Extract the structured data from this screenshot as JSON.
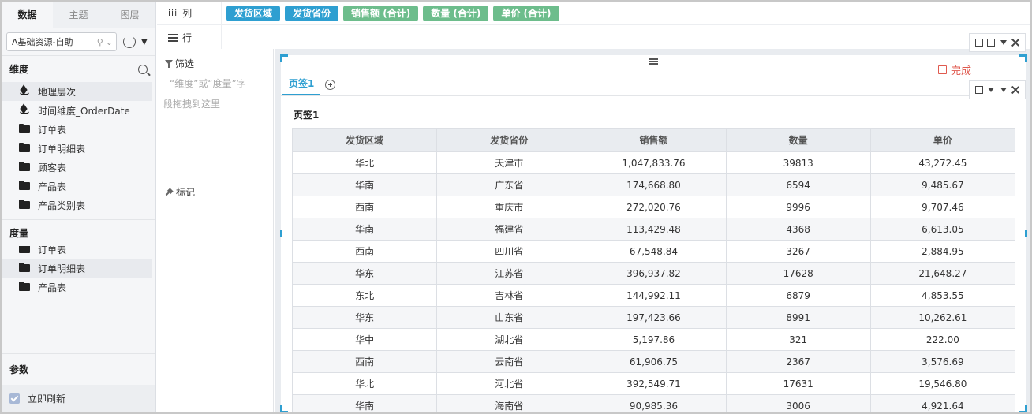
{
  "left_panel": {
    "tabs": [
      {
        "label": "数据",
        "active": true
      },
      {
        "label": "主题",
        "active": false
      },
      {
        "label": "图层",
        "active": false
      }
    ],
    "datasource": {
      "value": "A基础资源-自助"
    },
    "dimension": {
      "title": "维度",
      "items": [
        {
          "label": "地理层次",
          "icon": "layers-icon",
          "selected": true
        },
        {
          "label": "时间维度_OrderDate",
          "icon": "layers-icon",
          "selected": false
        },
        {
          "label": "订单表",
          "icon": "folder-icon",
          "selected": false
        },
        {
          "label": "订单明细表",
          "icon": "folder-icon",
          "selected": false
        },
        {
          "label": "顾客表",
          "icon": "folder-icon",
          "selected": false
        },
        {
          "label": "产品表",
          "icon": "folder-icon",
          "selected": false
        },
        {
          "label": "产品类别表",
          "icon": "folder-icon",
          "selected": false
        }
      ]
    },
    "measure": {
      "title": "度量",
      "items": [
        {
          "label": "订单表",
          "selected": false
        },
        {
          "label": "订单明细表",
          "selected": true
        },
        {
          "label": "产品表",
          "selected": false
        }
      ]
    },
    "params": {
      "title": "参数"
    },
    "instant_refresh": {
      "label": "立即刷新",
      "checked": true
    }
  },
  "shelves": {
    "column": {
      "label": "列",
      "pills": [
        {
          "label": "发货区域",
          "kind": "dimension"
        },
        {
          "label": "发货省份",
          "kind": "dimension"
        },
        {
          "label": "销售额 (合计)",
          "kind": "measure"
        },
        {
          "label": "数量 (合计)",
          "kind": "measure"
        },
        {
          "label": "单价 (合计)",
          "kind": "measure"
        }
      ]
    },
    "row": {
      "label": "行"
    }
  },
  "middle_panel": {
    "filter": {
      "title": "筛选",
      "hint_line1": "“维度”或“度量”字",
      "hint_line2": "段拖拽到这里"
    },
    "marks": {
      "title": "标记"
    }
  },
  "canvas": {
    "done_label": "完成",
    "tab": {
      "label": "页签1"
    },
    "table": {
      "title": "页签1",
      "columns": [
        "发货区域",
        "发货省份",
        "销售额",
        "数量",
        "单价"
      ],
      "rows": [
        [
          "华北",
          "天津市",
          "1,047,833.76",
          "39813",
          "43,272.45"
        ],
        [
          "华南",
          "广东省",
          "174,668.80",
          "6594",
          "9,485.67"
        ],
        [
          "西南",
          "重庆市",
          "272,020.76",
          "9996",
          "9,707.46"
        ],
        [
          "华南",
          "福建省",
          "113,429.48",
          "4368",
          "6,613.05"
        ],
        [
          "西南",
          "四川省",
          "67,548.84",
          "3267",
          "2,884.95"
        ],
        [
          "华东",
          "江苏省",
          "396,937.82",
          "17628",
          "21,648.27"
        ],
        [
          "东北",
          "吉林省",
          "144,992.11",
          "6879",
          "4,853.55"
        ],
        [
          "华东",
          "山东省",
          "197,423.66",
          "8991",
          "10,262.61"
        ],
        [
          "华中",
          "湖北省",
          "5,197.86",
          "321",
          "222.00"
        ],
        [
          "西南",
          "云南省",
          "61,906.75",
          "2367",
          "3,576.69"
        ],
        [
          "华北",
          "河北省",
          "392,549.71",
          "17631",
          "19,546.80"
        ],
        [
          "华南",
          "海南省",
          "90,985.36",
          "3006",
          "4,921.64"
        ]
      ]
    }
  },
  "colors": {
    "accent": "#2e9fd1",
    "measure_pill": "#6dbd8c",
    "done": "#e05a4f"
  }
}
